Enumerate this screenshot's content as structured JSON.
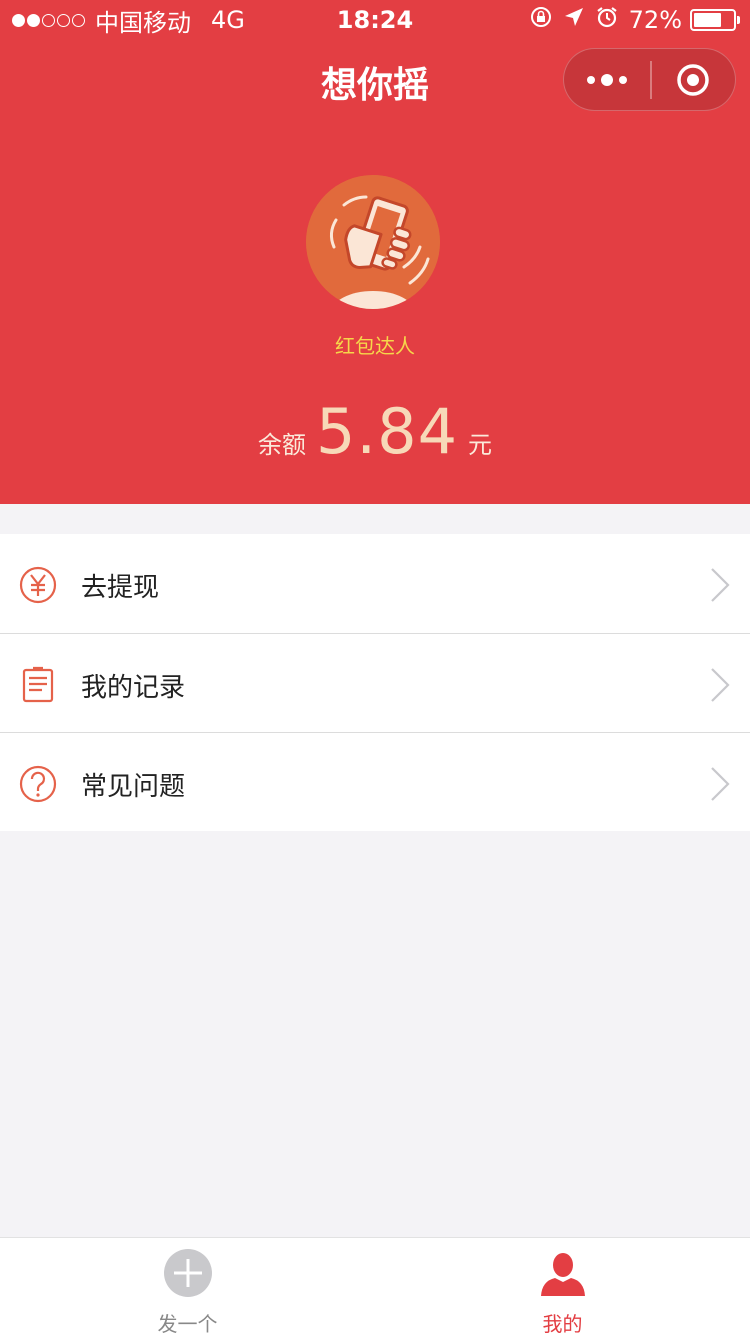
{
  "status_bar": {
    "carrier": "中国移动",
    "network": "4G",
    "time": "18:24",
    "battery_percent_text": "72%",
    "battery_level": 0.72,
    "signal_bars_filled": 2,
    "signal_bars_total": 5,
    "icons": [
      "rotation-lock-icon",
      "location-arrow-icon",
      "alarm-icon"
    ]
  },
  "header": {
    "app_title": "想你摇",
    "capsule": {
      "more_icon": "more-dots-icon",
      "close_icon": "target-close-icon"
    }
  },
  "profile": {
    "avatar_icon": "phone-in-hand-shake-icon",
    "title": "红包达人",
    "balance_label": "余额",
    "balance_value": "5.84",
    "balance_unit": "元"
  },
  "menu": {
    "items": [
      {
        "label": "去提现",
        "icon": "yuan-circle-icon"
      },
      {
        "label": "我的记录",
        "icon": "record-list-icon"
      },
      {
        "label": "常见问题",
        "icon": "question-circle-icon"
      }
    ],
    "chevron_icon": "chevron-right-icon"
  },
  "tabbar": {
    "tabs": [
      {
        "label": "发一个",
        "icon": "plus-circle-icon",
        "active": false
      },
      {
        "label": "我的",
        "icon": "person-icon",
        "active": true
      }
    ]
  },
  "colors": {
    "header_red": "#e33e43",
    "title_yellow": "#f6d74a",
    "balance_cream": "#f7d9b8",
    "page_background": "#f4f3f6",
    "active_tab": "#e33e43",
    "inactive_tab": "#888888"
  }
}
